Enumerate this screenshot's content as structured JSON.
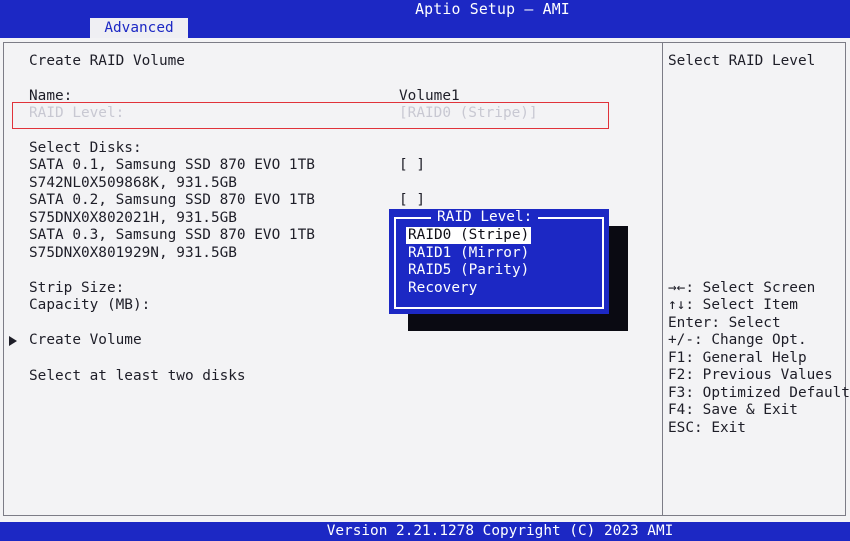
{
  "header": {
    "title": "Aptio Setup – AMI",
    "active_tab": "Advanced"
  },
  "main": {
    "section_title": "Create RAID Volume",
    "name_label": "Name:",
    "name_value": "Volume1",
    "raid_level_label": "RAID Level:",
    "raid_level_value": "[RAID0 (Stripe)]",
    "select_disks_label": "Select Disks:",
    "disks": [
      {
        "line1": "SATA 0.1, Samsung SSD 870 EVO 1TB",
        "line2": "S742NL0X509868K, 931.5GB",
        "checkbox": "[ ]"
      },
      {
        "line1": "SATA 0.2, Samsung SSD 870 EVO 1TB",
        "line2": "S75DNX0X802021H, 931.5GB",
        "checkbox": "[ ]"
      },
      {
        "line1": "SATA 0.3, Samsung SSD 870 EVO 1TB",
        "line2": "S75DNX0X801929N, 931.5GB",
        "checkbox": ""
      }
    ],
    "strip_size_label": "Strip Size:",
    "capacity_label": "Capacity (MB):",
    "create_volume_label": "Create Volume",
    "hint": "Select at least two disks"
  },
  "popup": {
    "title": "RAID Level:",
    "options": [
      "RAID0 (Stripe)",
      "RAID1 (Mirror)",
      "RAID5 (Parity)",
      "Recovery"
    ],
    "selected_index": 0
  },
  "help_panel": {
    "title": "Select RAID Level",
    "keys": [
      "→←: Select Screen",
      "↑↓: Select Item",
      "Enter: Select",
      "+/-: Change Opt.",
      "F1: General Help",
      "F2: Previous Values",
      "F3: Optimized Defaults",
      "F4: Save & Exit",
      "ESC: Exit"
    ]
  },
  "footer": {
    "version": "Version 2.21.1278 Copyright (C) 2023 AMI"
  },
  "colors": {
    "accent_blue": "#1c28c4",
    "background": "#f3f3f5",
    "focus_outline": "#e0323a"
  }
}
